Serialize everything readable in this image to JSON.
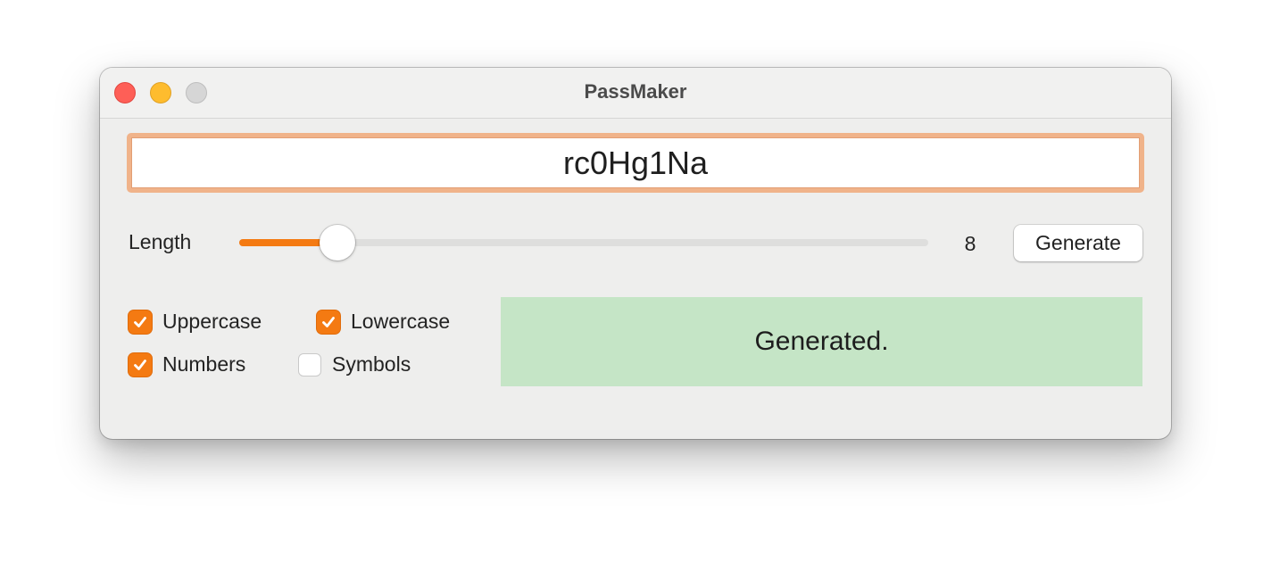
{
  "window": {
    "title": "PassMaker",
    "traffic_lights": [
      {
        "name": "close",
        "color": "#fe5f57"
      },
      {
        "name": "minimize",
        "color": "#febc2e"
      },
      {
        "name": "zoom",
        "color": "#d6d6d6"
      }
    ]
  },
  "password": {
    "value": "rc0Hg1Na"
  },
  "length": {
    "label": "Length",
    "value": 8,
    "value_text": "8",
    "fill_fraction": 0.143
  },
  "generate_button": {
    "label": "Generate"
  },
  "options": [
    {
      "id": "uppercase",
      "label": "Uppercase",
      "checked": true
    },
    {
      "id": "lowercase",
      "label": "Lowercase",
      "checked": true
    },
    {
      "id": "numbers",
      "label": "Numbers",
      "checked": true
    },
    {
      "id": "symbols",
      "label": "Symbols",
      "checked": false
    }
  ],
  "status": {
    "text": "Generated.",
    "color": "#c5e5c6"
  },
  "colors": {
    "accent": "#f47a12",
    "focus_ring": "#f0b38a",
    "window_bg": "#eeeeed"
  }
}
